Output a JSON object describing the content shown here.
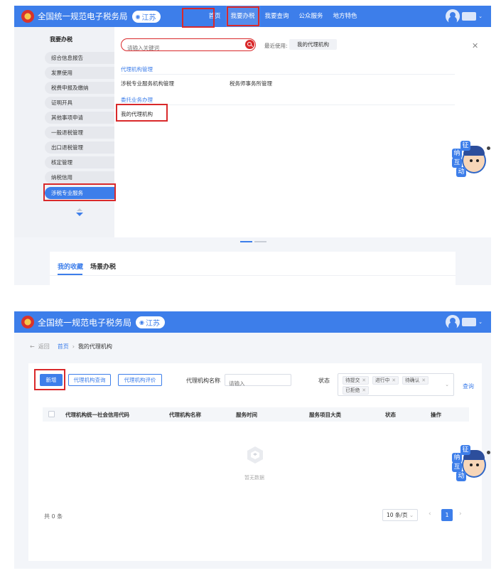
{
  "header": {
    "site_title": "全国统一规范电子税务局",
    "region": "江苏",
    "nav": [
      "首页",
      "我要办税",
      "我要查询",
      "公众服务",
      "地方特色"
    ]
  },
  "menu": {
    "left_title": "我要办税",
    "left_items": [
      "综合信息报告",
      "发票使用",
      "税费申报及缴纳",
      "证明开具",
      "其他事项申请",
      "一般退税管理",
      "出口退税管理",
      "核定管理",
      "纳税信用",
      "涉税专业服务"
    ],
    "search_placeholder": "请输入关键词",
    "recent_label": "最近使用:",
    "recent_item": "我的代理机构",
    "sections": [
      {
        "title": "代理机构管理",
        "links": [
          "涉税专业服务机构管理",
          "税务师事务所管理"
        ]
      },
      {
        "title": "委托业务办理",
        "links": [
          "我的代理机构"
        ]
      }
    ]
  },
  "favorites": {
    "tabs": [
      "我的收藏",
      "场景办税"
    ]
  },
  "mascot": {
    "chars": [
      "征",
      "纳",
      "互",
      "动"
    ]
  },
  "page2": {
    "back": "返回",
    "breadcrumb_home": "首页",
    "breadcrumb_current": "我的代理机构",
    "buttons": {
      "add": "新增",
      "agency_query": "代理机构查询",
      "agency_eval": "代理机构评价",
      "query": "查询"
    },
    "filter": {
      "name_label": "代理机构名称",
      "name_placeholder": "请输入",
      "status_label": "状态",
      "status_tags": [
        "待提交",
        "进行中",
        "待确认",
        "已拒绝"
      ]
    },
    "table_headers": [
      "代理机构统一社会信用代码",
      "代理机构名称",
      "服务时间",
      "服务项目大类",
      "状态",
      "操作"
    ],
    "empty_text": "暂无数据",
    "total": "共 0 条",
    "page_size": "10 条/页",
    "current_page": "1"
  },
  "colors": {
    "primary": "#3d7eea",
    "highlight": "#d9292b"
  }
}
